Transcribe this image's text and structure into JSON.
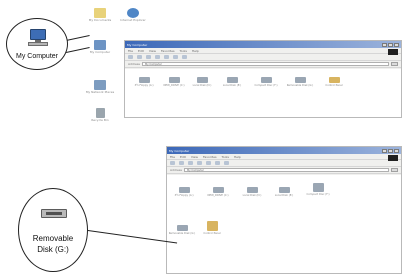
{
  "desktop": {
    "icons": [
      {
        "name": "my-documents",
        "label": "My Documents"
      },
      {
        "name": "internet-explorer",
        "label": "Internet Explorer"
      },
      {
        "name": "my-computer",
        "label": "My Computer"
      },
      {
        "name": "network",
        "label": "My Network Places"
      },
      {
        "name": "recycle-bin",
        "label": "Recycle Bin"
      }
    ]
  },
  "callout_top": {
    "label": "My Computer"
  },
  "callout_bottom": {
    "label_line1": "Removable",
    "label_line2": "Disk (G:)"
  },
  "window_top": {
    "title": "My Computer",
    "menu": [
      "File",
      "Edit",
      "View",
      "Favorites",
      "Tools",
      "Help"
    ],
    "address_label": "Address",
    "address_value": "My Computer",
    "drives": [
      {
        "label": "3½ Floppy (A:)",
        "color": "#9aa6b3"
      },
      {
        "label": "NEW_DRIVE (C:)",
        "color": "#9aa6b3"
      },
      {
        "label": "Local Disk (D:)",
        "color": "#9aa6b3"
      },
      {
        "label": "Local Disk (E:)",
        "color": "#9aa6b3"
      },
      {
        "label": "Compact Disc (F:)",
        "color": "#9aa6b3"
      },
      {
        "label": "Removable Disk (G:)",
        "color": "#9aa6b3"
      },
      {
        "label": "Control Panel",
        "color": "#d8b460"
      }
    ]
  },
  "window_bottom": {
    "title": "My Computer",
    "menu": [
      "File",
      "Edit",
      "View",
      "Favorites",
      "Tools",
      "Help"
    ],
    "address_label": "Address",
    "address_value": "My Computer",
    "drives": [
      {
        "label": "3½ Floppy (A:)",
        "color": "#9aa6b3"
      },
      {
        "label": "NEW_DRIVE (C:)",
        "color": "#9aa6b3"
      },
      {
        "label": "Local Disk (D:)",
        "color": "#9aa6b3"
      },
      {
        "label": "Local Disk (E:)",
        "color": "#9aa6b3"
      },
      {
        "label": "Compact Disc (F:)",
        "color": "#9aa6b3"
      },
      {
        "label": "Removable Disk (G:)",
        "color": "#9aa6b3"
      },
      {
        "label": "Control Panel",
        "color": "#d8b460"
      }
    ]
  }
}
